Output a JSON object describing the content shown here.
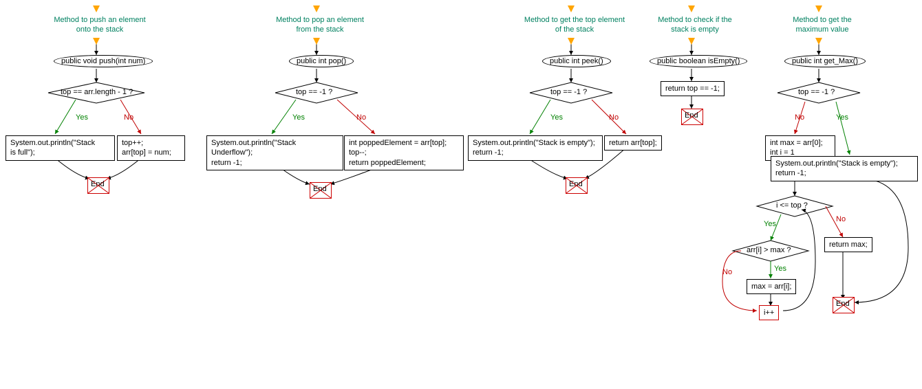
{
  "chart_data": {
    "type": "flowchart",
    "charts": [
      {
        "title": "Method to push an element onto the stack",
        "start": "public void push(int num)",
        "decision": "top == arr.length - 1 ?",
        "yes": "System.out.println(\"Stack is full\");",
        "no": "top++;\narr[top] = num;",
        "end": "End"
      },
      {
        "title": "Method to pop an element from the stack",
        "start": "public int pop()",
        "decision": "top == -1 ?",
        "yes": "System.out.println(\"Stack Underflow\");\nreturn -1;",
        "no": "int poppedElement = arr[top];\ntop--;\nreturn poppedElement;",
        "end": "End"
      },
      {
        "title": "Method to get the top element of the stack",
        "start": "public int peek()",
        "decision": "top == -1 ?",
        "yes": "System.out.println(\"Stack is empty\");\nreturn -1;",
        "no": "return arr[top];",
        "end": "End"
      },
      {
        "title": "Method to check if the stack is empty",
        "start": "public boolean isEmpty()",
        "body": "return top == -1;",
        "end": "End"
      },
      {
        "title": "Method to get the maximum value",
        "start": "public int get_Max()",
        "decision": "top == -1 ?",
        "no": "int max = arr[0];\nint i = 1",
        "yes": "System.out.println(\"Stack is empty\");\nreturn -1;",
        "loop_cond": "i <= top ?",
        "loop_body_cond": "arr[i] > max ?",
        "loop_body_yes": "max = arr[i];",
        "loop_inc": "i++",
        "loop_no": "return max;",
        "end": "End"
      }
    ]
  },
  "labels": {
    "yes": "Yes",
    "no": "No",
    "end": "End"
  },
  "c1": {
    "title": "Method to push an element\nonto the stack",
    "start": "public void push(int num)",
    "cond": "top == arr.length - 1 ?",
    "yes": "System.out.println(\"Stack\nis full\");",
    "no": "top++;\narr[top] = num;"
  },
  "c2": {
    "title": "Method to pop an element\nfrom the stack",
    "start": "public int pop()",
    "cond": "top == -1 ?",
    "yes": "System.out.println(\"Stack Underflow\");\nreturn -1;",
    "no": "int poppedElement = arr[top];\ntop--;\nreturn poppedElement;"
  },
  "c3": {
    "title": "Method to get the top\nelement of the stack",
    "start": "public int peek()",
    "cond": "top == -1 ?",
    "yes": "System.out.println(\"Stack is empty\");\nreturn -1;",
    "no": "return arr[top];"
  },
  "c4": {
    "title": "Method to check if\nthe stack is empty",
    "start": "public boolean isEmpty()",
    "body": "return top == -1;"
  },
  "c5": {
    "title": "Method to get the\nmaximum value",
    "start": "public int get_Max()",
    "cond": "top == -1 ?",
    "no": "int max = arr[0];\nint i = 1",
    "yes": "System.out.println(\"Stack is empty\");\nreturn -1;",
    "loop_cond": "i <= top ?",
    "inner_cond": "arr[i] > max ?",
    "inner_yes": "max = arr[i];",
    "inc": "i++",
    "ret": "return max;"
  }
}
